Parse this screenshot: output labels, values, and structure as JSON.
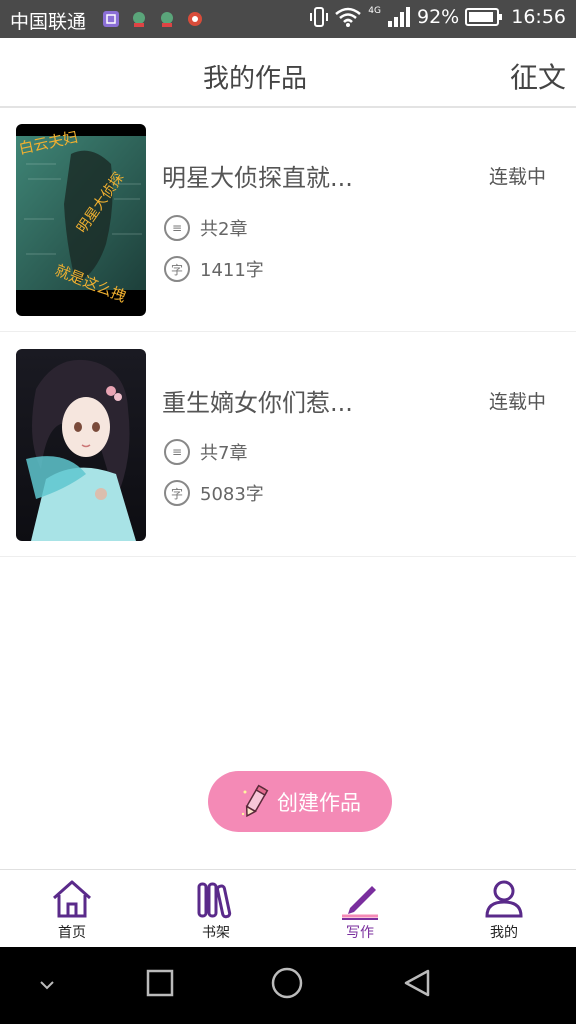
{
  "status_bar": {
    "carrier": "中国联通",
    "network": "4G",
    "battery": "92%",
    "battery_level": 0.92,
    "time": "16:56"
  },
  "header": {
    "title": "我的作品",
    "action": "征文"
  },
  "works": [
    {
      "title": "明星大侦探直就...",
      "status": "连载中",
      "chapters": "共2章",
      "words": "1411字",
      "cover_text": [
        "白云夫妇",
        "明星大侦探",
        "就是这么拽"
      ]
    },
    {
      "title": "重生嫡女你们惹...",
      "status": "连载中",
      "chapters": "共7章",
      "words": "5083字"
    }
  ],
  "icons": {
    "chapters": "≡",
    "words": "字"
  },
  "create_button": {
    "label": "创建作品"
  },
  "bottom_nav": [
    {
      "label": "首页",
      "icon": "home-icon"
    },
    {
      "label": "书架",
      "icon": "bookshelf-icon"
    },
    {
      "label": "写作",
      "icon": "write-icon",
      "active": true
    },
    {
      "label": "我的",
      "icon": "user-icon"
    }
  ],
  "colors": {
    "accent": "#7a2e9e",
    "create_button": "#f48ab6",
    "cover_gold": "#f0b030"
  }
}
